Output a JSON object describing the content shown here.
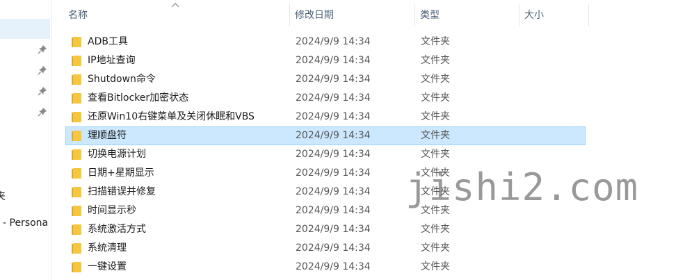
{
  "nav": {
    "label_folder_partial": "夹",
    "label_persona_partial": "- Persona"
  },
  "columns": {
    "name": "名称",
    "modified": "修改日期",
    "type": "类型",
    "size": "大小"
  },
  "rows": [
    {
      "name": "ADB工具",
      "modified": "2024/9/9 14:34",
      "type": "文件夹",
      "selected": false
    },
    {
      "name": "IP地址查询",
      "modified": "2024/9/9 14:34",
      "type": "文件夹",
      "selected": false
    },
    {
      "name": "Shutdown命令",
      "modified": "2024/9/9 14:34",
      "type": "文件夹",
      "selected": false
    },
    {
      "name": "查看Bitlocker加密状态",
      "modified": "2024/9/9 14:34",
      "type": "文件夹",
      "selected": false
    },
    {
      "name": "还原Win10右键菜单及关闭休眠和VBS",
      "modified": "2024/9/9 14:34",
      "type": "文件夹",
      "selected": false
    },
    {
      "name": "理顺盘符",
      "modified": "2024/9/9 14:34",
      "type": "文件夹",
      "selected": true
    },
    {
      "name": "切换电源计划",
      "modified": "2024/9/9 14:34",
      "type": "文件夹",
      "selected": false
    },
    {
      "name": "日期+星期显示",
      "modified": "2024/9/9 14:34",
      "type": "文件夹",
      "selected": false
    },
    {
      "name": "扫描错误并修复",
      "modified": "2024/9/9 14:34",
      "type": "文件夹",
      "selected": false
    },
    {
      "name": "时间显示秒",
      "modified": "2024/9/9 14:34",
      "type": "文件夹",
      "selected": false
    },
    {
      "name": "系统激活方式",
      "modified": "2024/9/9 14:34",
      "type": "文件夹",
      "selected": false
    },
    {
      "name": "系统清理",
      "modified": "2024/9/9 14:34",
      "type": "文件夹",
      "selected": false
    },
    {
      "name": "一键设置",
      "modified": "2024/9/9 14:34",
      "type": "文件夹",
      "selected": false
    }
  ],
  "watermark": "jishi2.com",
  "icons": {
    "folder": "folder-icon",
    "pin": "pin-icon",
    "sort": "sort-up-icon"
  },
  "colors": {
    "selection_fill": "#cce8ff",
    "selection_border": "#99d1ff",
    "folder": "#f5c640",
    "header_text": "#4c607a"
  }
}
